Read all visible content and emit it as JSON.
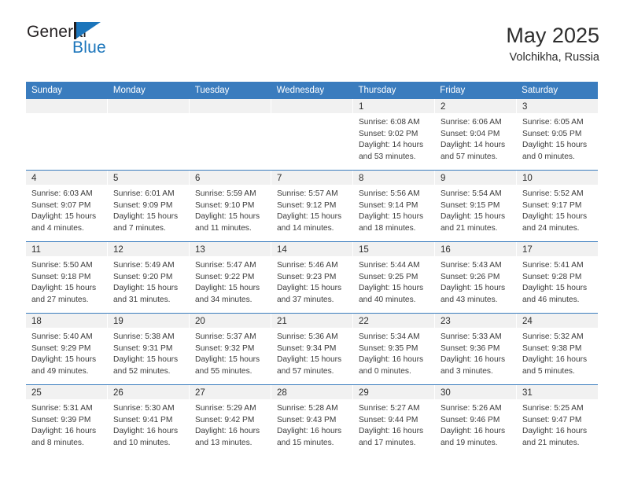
{
  "brand": {
    "word_one": "General",
    "word_two": "Blue",
    "flag_icon": "blue-triangle-flag-icon",
    "accent_color": "#1b75bb"
  },
  "header": {
    "title": "May 2025",
    "subtitle": "Volchikha, Russia"
  },
  "theme": {
    "header_blue": "#3a7cbe",
    "daynum_band": "#f1f1f1",
    "text": "#3b3b3b"
  },
  "calendar": {
    "weekday_headers": [
      "Sunday",
      "Monday",
      "Tuesday",
      "Wednesday",
      "Thursday",
      "Friday",
      "Saturday"
    ],
    "weeks": [
      [
        {
          "day": "",
          "lines": []
        },
        {
          "day": "",
          "lines": []
        },
        {
          "day": "",
          "lines": []
        },
        {
          "day": "",
          "lines": []
        },
        {
          "day": "1",
          "lines": [
            "Sunrise: 6:08 AM",
            "Sunset: 9:02 PM",
            "Daylight: 14 hours",
            "and 53 minutes."
          ]
        },
        {
          "day": "2",
          "lines": [
            "Sunrise: 6:06 AM",
            "Sunset: 9:04 PM",
            "Daylight: 14 hours",
            "and 57 minutes."
          ]
        },
        {
          "day": "3",
          "lines": [
            "Sunrise: 6:05 AM",
            "Sunset: 9:05 PM",
            "Daylight: 15 hours",
            "and 0 minutes."
          ]
        }
      ],
      [
        {
          "day": "4",
          "lines": [
            "Sunrise: 6:03 AM",
            "Sunset: 9:07 PM",
            "Daylight: 15 hours",
            "and 4 minutes."
          ]
        },
        {
          "day": "5",
          "lines": [
            "Sunrise: 6:01 AM",
            "Sunset: 9:09 PM",
            "Daylight: 15 hours",
            "and 7 minutes."
          ]
        },
        {
          "day": "6",
          "lines": [
            "Sunrise: 5:59 AM",
            "Sunset: 9:10 PM",
            "Daylight: 15 hours",
            "and 11 minutes."
          ]
        },
        {
          "day": "7",
          "lines": [
            "Sunrise: 5:57 AM",
            "Sunset: 9:12 PM",
            "Daylight: 15 hours",
            "and 14 minutes."
          ]
        },
        {
          "day": "8",
          "lines": [
            "Sunrise: 5:56 AM",
            "Sunset: 9:14 PM",
            "Daylight: 15 hours",
            "and 18 minutes."
          ]
        },
        {
          "day": "9",
          "lines": [
            "Sunrise: 5:54 AM",
            "Sunset: 9:15 PM",
            "Daylight: 15 hours",
            "and 21 minutes."
          ]
        },
        {
          "day": "10",
          "lines": [
            "Sunrise: 5:52 AM",
            "Sunset: 9:17 PM",
            "Daylight: 15 hours",
            "and 24 minutes."
          ]
        }
      ],
      [
        {
          "day": "11",
          "lines": [
            "Sunrise: 5:50 AM",
            "Sunset: 9:18 PM",
            "Daylight: 15 hours",
            "and 27 minutes."
          ]
        },
        {
          "day": "12",
          "lines": [
            "Sunrise: 5:49 AM",
            "Sunset: 9:20 PM",
            "Daylight: 15 hours",
            "and 31 minutes."
          ]
        },
        {
          "day": "13",
          "lines": [
            "Sunrise: 5:47 AM",
            "Sunset: 9:22 PM",
            "Daylight: 15 hours",
            "and 34 minutes."
          ]
        },
        {
          "day": "14",
          "lines": [
            "Sunrise: 5:46 AM",
            "Sunset: 9:23 PM",
            "Daylight: 15 hours",
            "and 37 minutes."
          ]
        },
        {
          "day": "15",
          "lines": [
            "Sunrise: 5:44 AM",
            "Sunset: 9:25 PM",
            "Daylight: 15 hours",
            "and 40 minutes."
          ]
        },
        {
          "day": "16",
          "lines": [
            "Sunrise: 5:43 AM",
            "Sunset: 9:26 PM",
            "Daylight: 15 hours",
            "and 43 minutes."
          ]
        },
        {
          "day": "17",
          "lines": [
            "Sunrise: 5:41 AM",
            "Sunset: 9:28 PM",
            "Daylight: 15 hours",
            "and 46 minutes."
          ]
        }
      ],
      [
        {
          "day": "18",
          "lines": [
            "Sunrise: 5:40 AM",
            "Sunset: 9:29 PM",
            "Daylight: 15 hours",
            "and 49 minutes."
          ]
        },
        {
          "day": "19",
          "lines": [
            "Sunrise: 5:38 AM",
            "Sunset: 9:31 PM",
            "Daylight: 15 hours",
            "and 52 minutes."
          ]
        },
        {
          "day": "20",
          "lines": [
            "Sunrise: 5:37 AM",
            "Sunset: 9:32 PM",
            "Daylight: 15 hours",
            "and 55 minutes."
          ]
        },
        {
          "day": "21",
          "lines": [
            "Sunrise: 5:36 AM",
            "Sunset: 9:34 PM",
            "Daylight: 15 hours",
            "and 57 minutes."
          ]
        },
        {
          "day": "22",
          "lines": [
            "Sunrise: 5:34 AM",
            "Sunset: 9:35 PM",
            "Daylight: 16 hours",
            "and 0 minutes."
          ]
        },
        {
          "day": "23",
          "lines": [
            "Sunrise: 5:33 AM",
            "Sunset: 9:36 PM",
            "Daylight: 16 hours",
            "and 3 minutes."
          ]
        },
        {
          "day": "24",
          "lines": [
            "Sunrise: 5:32 AM",
            "Sunset: 9:38 PM",
            "Daylight: 16 hours",
            "and 5 minutes."
          ]
        }
      ],
      [
        {
          "day": "25",
          "lines": [
            "Sunrise: 5:31 AM",
            "Sunset: 9:39 PM",
            "Daylight: 16 hours",
            "and 8 minutes."
          ]
        },
        {
          "day": "26",
          "lines": [
            "Sunrise: 5:30 AM",
            "Sunset: 9:41 PM",
            "Daylight: 16 hours",
            "and 10 minutes."
          ]
        },
        {
          "day": "27",
          "lines": [
            "Sunrise: 5:29 AM",
            "Sunset: 9:42 PM",
            "Daylight: 16 hours",
            "and 13 minutes."
          ]
        },
        {
          "day": "28",
          "lines": [
            "Sunrise: 5:28 AM",
            "Sunset: 9:43 PM",
            "Daylight: 16 hours",
            "and 15 minutes."
          ]
        },
        {
          "day": "29",
          "lines": [
            "Sunrise: 5:27 AM",
            "Sunset: 9:44 PM",
            "Daylight: 16 hours",
            "and 17 minutes."
          ]
        },
        {
          "day": "30",
          "lines": [
            "Sunrise: 5:26 AM",
            "Sunset: 9:46 PM",
            "Daylight: 16 hours",
            "and 19 minutes."
          ]
        },
        {
          "day": "31",
          "lines": [
            "Sunrise: 5:25 AM",
            "Sunset: 9:47 PM",
            "Daylight: 16 hours",
            "and 21 minutes."
          ]
        }
      ]
    ]
  }
}
